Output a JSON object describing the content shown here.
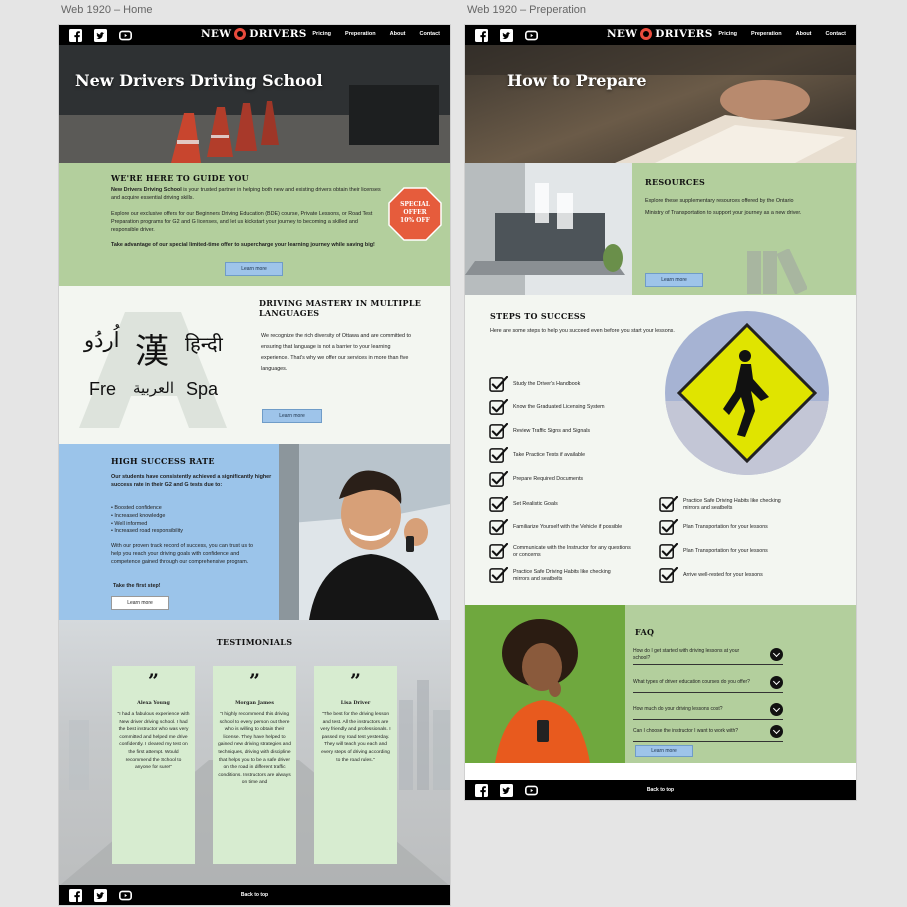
{
  "frames": {
    "home_label": "Web 1920 – Home",
    "prep_label": "Web 1920 – Preperation"
  },
  "nav": {
    "brand_left": "NEW",
    "brand_right": "DRIVERS",
    "links": [
      "Pricing",
      "Preperation",
      "About",
      "Contact"
    ]
  },
  "social_icons": [
    "facebook-icon",
    "twitter-icon",
    "youtube-icon"
  ],
  "home": {
    "hero_title": "New Drivers Driving School",
    "guide": {
      "heading": "WE'RE HERE TO GUIDE YOU",
      "p1_bold": "New Drivers Driving School",
      "p1_rest": " is your trusted partner in helping both new and existing drivers obtain their licenses and acquire essential driving skills.",
      "p2": "Explore our exclusive offers for our Beginners Driving Education (BDE) course, Private Lessons, or Road Test Preparation programs for G2 and G licenses, and let us kickstart your journey to becoming a skilled and responsible driver.",
      "p3": "Take advantage of our special limited-time offer to supercharge your learning journey while saving big!",
      "button": "Learn more",
      "badge_line1": "SPECIAL",
      "badge_line2": "OFFER",
      "badge_line3": "10% OFF"
    },
    "languages": {
      "heading": "DRIVING MASTERY IN MULTIPLE LANGUAGES",
      "body": "We recognize the rich diversity of Ottawa and are committed to ensuring that language is not a barrier to your learning experience. That's why we offer our services in more than five languages.",
      "button": "Learn more",
      "glyph_urdu": "اُردُو",
      "glyph_han": "漢",
      "glyph_hindi": "हिन्दी",
      "glyph_fre": "Fre",
      "glyph_arabic": "العربية",
      "glyph_spa": "Spa"
    },
    "success": {
      "heading": "HIGH SUCCESS RATE",
      "intro": "Our students have consistently achieved a significantly higher success rate in their G2 and G tests due to:",
      "bullets": [
        "• Boosted confidence",
        "• Increased knowledge",
        "• Well informed",
        "• Increased road responsibility"
      ],
      "body": "With our proven track record of success, you can trust us to help you reach your driving goals with confidence and competence gained through our comprehensive program.",
      "cta": "Take the first step!",
      "button": "Learn more"
    },
    "testimonials": {
      "heading": "TESTIMONIALS",
      "items": [
        {
          "name": "Alexa Young",
          "text": "\"I had a fabulous experience with New driver driving school. I had the best instructor who was very committed and helped me drive confidently. I cleared my test on the first attempt. Would recommend the School to anyone for sure!\""
        },
        {
          "name": "Morgan James",
          "text": "\"I highly recommend this driving school to every person out there who is willing to obtain their license. They have helped to gained new driving strategies and techniques, driving with discipline that helps you to be a safe driver on the road in different traffic conditions. Instructors are always on time and"
        },
        {
          "name": "Lisa Driver",
          "text": "\"The best for the driving lesson and test. All the instructors are very friendly and professionals. I passed my road test yesterday. They will teach you each and every steps of driving according to the road rules.\""
        }
      ]
    },
    "footer": "Back to top"
  },
  "prep": {
    "hero_title": "How to Prepare",
    "resources": {
      "heading": "RESOURCES",
      "body": "Explore these supplementary resources offered by the Ontario Ministry of Transportation to support your journey as a new driver.",
      "button": "Learn more"
    },
    "steps": {
      "heading": "STEPS TO SUCCESS",
      "intro": "Here are some steps to help you succeed even before you start your lessons.",
      "left": [
        "Study the Driver's Handbook",
        "Know the Graduated Licensing System",
        "Review Traffic Signs and Signals",
        "Take Practice Tests if available",
        "Prepare Required Documents",
        "Set Realistic Goals",
        "Familiarize Yourself with the Vehicle if possible",
        "Communicate with the Instructor for any questions or concerns",
        "Practice Safe Driving Habits like checking mirrors and seatbelts"
      ],
      "right": [
        "Practice Safe Driving Habits like checking mirrors and seatbelts",
        "Plan Transportation for your lessons",
        "Plan Transportation for your lessons",
        "Arrive well-rested for your lessons"
      ]
    },
    "faq": {
      "heading": "FAQ",
      "items": [
        "How do I get started with driving lessons at your school?",
        "What types of driver education courses do you offer?",
        "How much do your driving lessons cost?",
        "Can I choose the instructor I want to work with?"
      ],
      "button": "Learn more"
    },
    "footer": "Back to top"
  }
}
